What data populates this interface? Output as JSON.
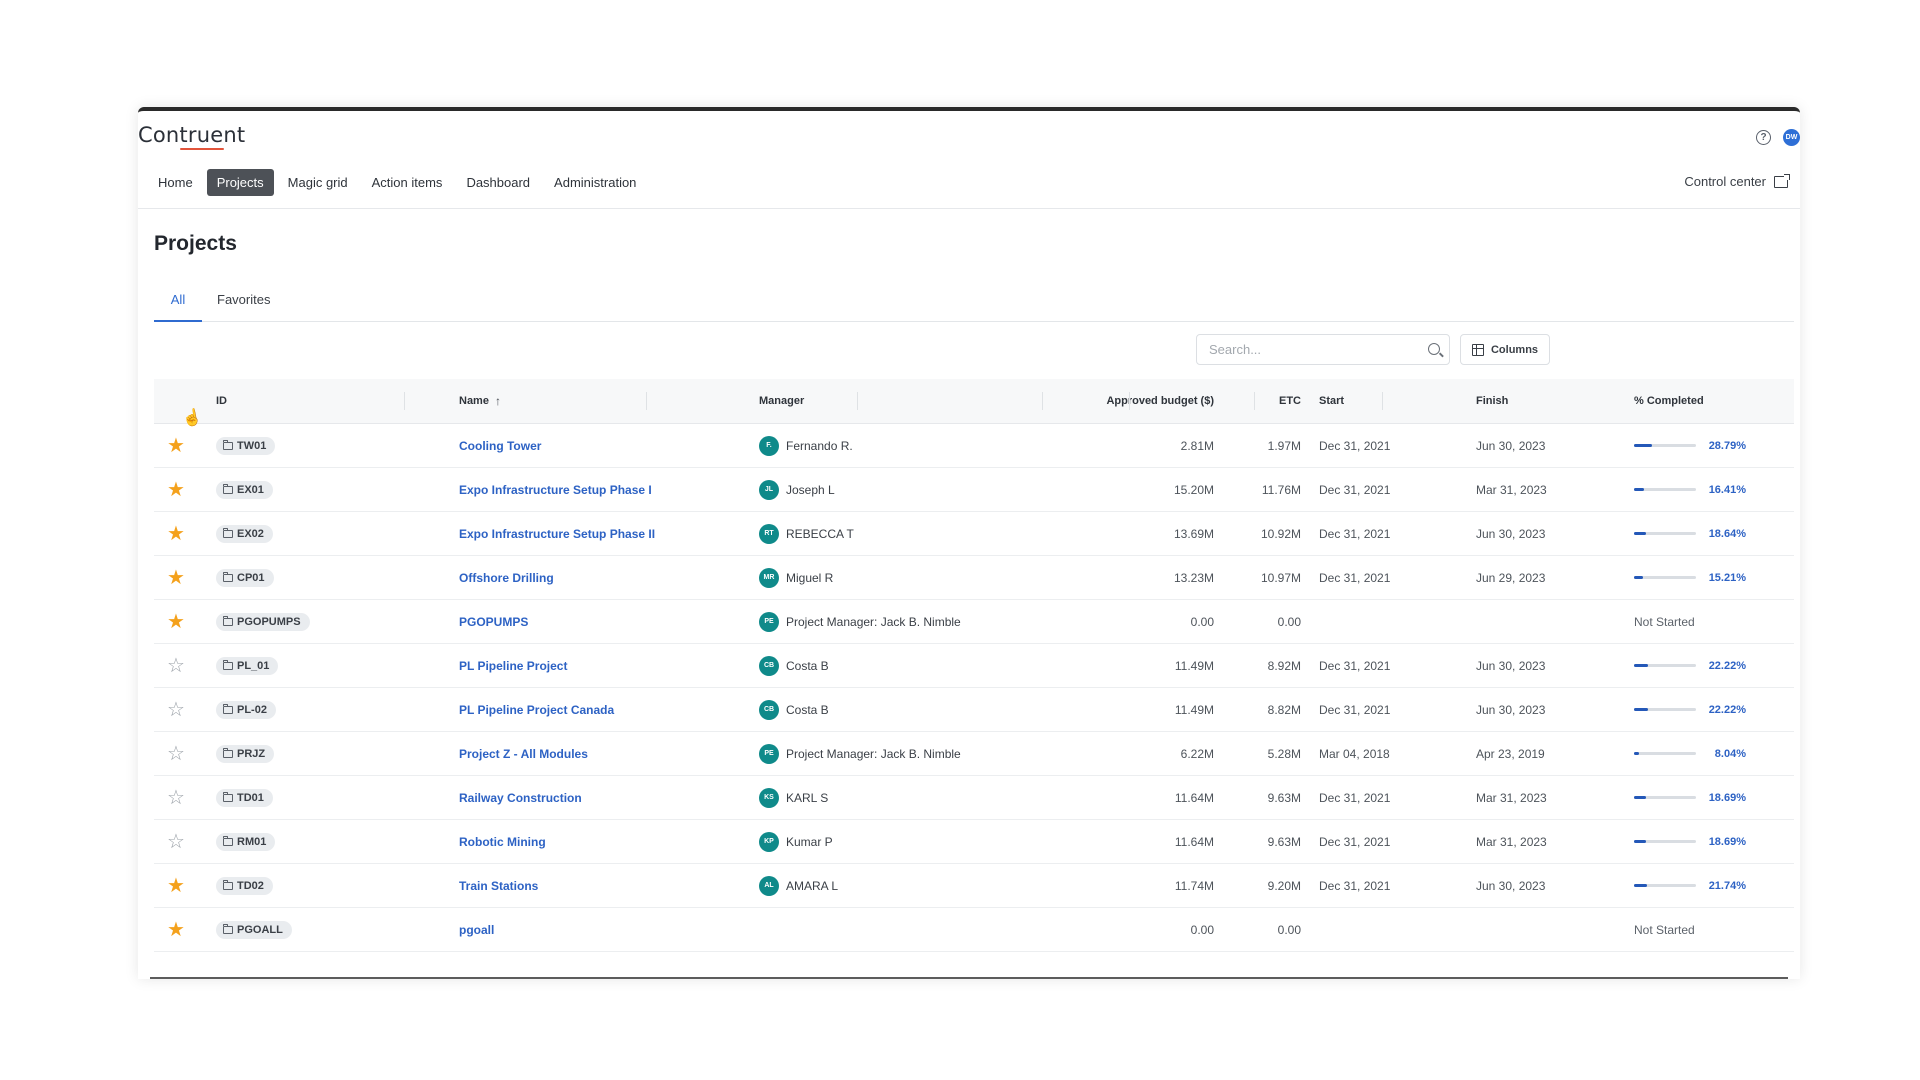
{
  "app": {
    "logo_text": "Contruent",
    "user_initials": "DW"
  },
  "nav": {
    "items": [
      {
        "label": "Home",
        "active": false
      },
      {
        "label": "Projects",
        "active": true
      },
      {
        "label": "Magic grid",
        "active": false
      },
      {
        "label": "Action items",
        "active": false
      },
      {
        "label": "Dashboard",
        "active": false
      },
      {
        "label": "Administration",
        "active": false
      }
    ],
    "control_center_label": "Control center"
  },
  "page": {
    "title": "Projects"
  },
  "tabs": {
    "all_label": "All",
    "favorites_label": "Favorites",
    "active": "All"
  },
  "toolbar": {
    "search_placeholder": "Search...",
    "search_value": "",
    "columns_label": "Columns"
  },
  "table": {
    "headers": {
      "id": "ID",
      "name": "Name",
      "manager": "Manager",
      "budget": "Approved budget ($)",
      "etc": "ETC",
      "start": "Start",
      "finish": "Finish",
      "completed": "% Completed"
    },
    "sort": {
      "column": "Name",
      "direction": "ascending"
    },
    "rows": [
      {
        "favorite": true,
        "id": "TW01",
        "name": "Cooling Tower",
        "manager_initials": "F.",
        "manager": "Fernando R.",
        "budget": "2.81M",
        "etc": "1.97M",
        "start": "Dec 31, 2021",
        "finish": "Jun 30, 2023",
        "pct": "28.79%",
        "pct_value": 28.79
      },
      {
        "favorite": true,
        "id": "EX01",
        "name": "Expo Infrastructure Setup Phase I",
        "manager_initials": "JL",
        "manager": "Joseph L",
        "budget": "15.20M",
        "etc": "11.76M",
        "start": "Dec 31, 2021",
        "finish": "Mar 31, 2023",
        "pct": "16.41%",
        "pct_value": 16.41
      },
      {
        "favorite": true,
        "id": "EX02",
        "name": "Expo Infrastructure Setup Phase II",
        "manager_initials": "RT",
        "manager": "REBECCA T",
        "budget": "13.69M",
        "etc": "10.92M",
        "start": "Dec 31, 2021",
        "finish": "Jun 30, 2023",
        "pct": "18.64%",
        "pct_value": 18.64
      },
      {
        "favorite": true,
        "id": "CP01",
        "name": "Offshore Drilling",
        "manager_initials": "MR",
        "manager": "Miguel R",
        "budget": "13.23M",
        "etc": "10.97M",
        "start": "Dec 31, 2021",
        "finish": "Jun 29, 2023",
        "pct": "15.21%",
        "pct_value": 15.21
      },
      {
        "favorite": true,
        "id": "PGOPUMPS",
        "name": "PGOPUMPS",
        "manager_initials": "PE",
        "manager": "Project Manager: Jack B. Nimble",
        "budget": "0.00",
        "etc": "0.00",
        "start": "",
        "finish": "",
        "pct": "Not Started",
        "pct_value": null
      },
      {
        "favorite": false,
        "id": "PL_01",
        "name": "PL Pipeline Project",
        "manager_initials": "CB",
        "manager": "Costa B",
        "budget": "11.49M",
        "etc": "8.92M",
        "start": "Dec 31, 2021",
        "finish": "Jun 30, 2023",
        "pct": "22.22%",
        "pct_value": 22.22
      },
      {
        "favorite": false,
        "id": "PL-02",
        "name": "PL Pipeline Project Canada",
        "manager_initials": "CB",
        "manager": "Costa B",
        "budget": "11.49M",
        "etc": "8.82M",
        "start": "Dec 31, 2021",
        "finish": "Jun 30, 2023",
        "pct": "22.22%",
        "pct_value": 22.22
      },
      {
        "favorite": false,
        "id": "PRJZ",
        "name": "Project Z - All Modules",
        "manager_initials": "PE",
        "manager": "Project Manager: Jack B. Nimble",
        "budget": "6.22M",
        "etc": "5.28M",
        "start": "Mar 04, 2018",
        "finish": "Apr 23, 2019",
        "pct": "8.04%",
        "pct_value": 8.04
      },
      {
        "favorite": false,
        "id": "TD01",
        "name": "Railway Construction",
        "manager_initials": "KS",
        "manager": "KARL S",
        "budget": "11.64M",
        "etc": "9.63M",
        "start": "Dec 31, 2021",
        "finish": "Mar 31, 2023",
        "pct": "18.69%",
        "pct_value": 18.69
      },
      {
        "favorite": false,
        "id": "RM01",
        "name": "Robotic Mining",
        "manager_initials": "KP",
        "manager": "Kumar P",
        "budget": "11.64M",
        "etc": "9.63M",
        "start": "Dec 31, 2021",
        "finish": "Mar 31, 2023",
        "pct": "18.69%",
        "pct_value": 18.69
      },
      {
        "favorite": true,
        "id": "TD02",
        "name": "Train Stations",
        "manager_initials": "AL",
        "manager": "AMARA L",
        "budget": "11.74M",
        "etc": "9.20M",
        "start": "Dec 31, 2021",
        "finish": "Jun 30, 2023",
        "pct": "21.74%",
        "pct_value": 21.74
      },
      {
        "favorite": true,
        "id": "PGOALL",
        "name": "pgoall",
        "manager_initials": "",
        "manager": "",
        "budget": "0.00",
        "etc": "0.00",
        "start": "",
        "finish": "",
        "pct": "Not Started",
        "pct_value": null
      }
    ]
  },
  "colors": {
    "accent": "#2d62c4",
    "star_on": "#f4a11c",
    "avatar": "#0f8a8a",
    "nav_active": "#4d5157"
  }
}
